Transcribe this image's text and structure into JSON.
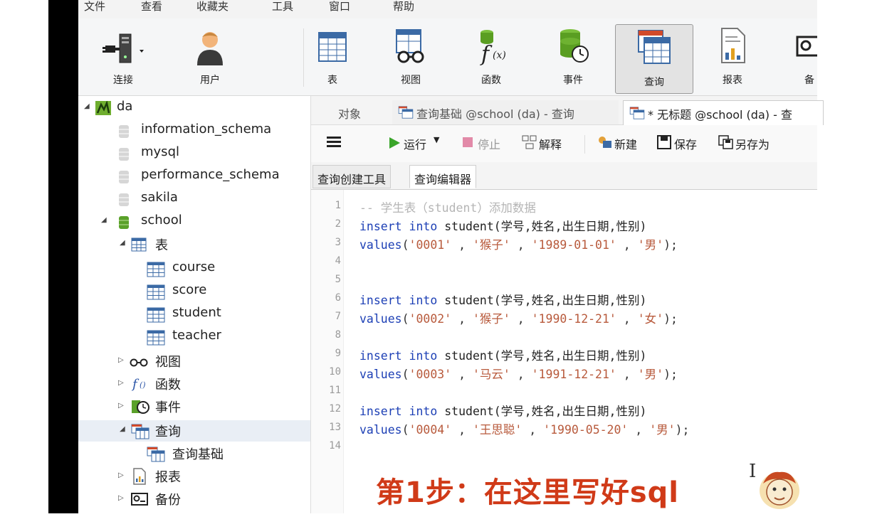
{
  "menu": [
    "文件",
    "查看",
    "收藏夹",
    "工具",
    "窗口",
    "帮助"
  ],
  "toolbar": {
    "connect": "连接",
    "user": "用户",
    "table": "表",
    "view": "视图",
    "function": "函数",
    "event": "事件",
    "query": "查询",
    "report": "报表",
    "backup": "备"
  },
  "tree": {
    "connection": "da",
    "databases": [
      "information_schema",
      "mysql",
      "performance_schema",
      "sakila",
      "school"
    ],
    "tables_group": "表",
    "tables": [
      "course",
      "score",
      "student",
      "teacher"
    ],
    "views": "视图",
    "functions": "函数",
    "events": "事件",
    "queries": "查询",
    "query_item": "查询基础",
    "reports": "报表",
    "backups": "备份"
  },
  "tabs": {
    "objects": "对象",
    "tab1": "查询基础 @school (da) - 查询",
    "tab2": "* 无标题 @school (da) - 查"
  },
  "querybar": {
    "run": "运行",
    "stop": "停止",
    "explain": "解释",
    "new": "新建",
    "save": "保存",
    "save_as": "另存为"
  },
  "subtabs": {
    "builder": "查询创建工具",
    "editor": "查询编辑器"
  },
  "editor": {
    "line_numbers": [
      "1",
      "2",
      "3",
      "4",
      "5",
      "6",
      "7",
      "8",
      "9",
      "10",
      "11",
      "12",
      "13",
      "14"
    ],
    "comment": "-- 学生表（student）添加数据",
    "insert_kw": "insert into",
    "insert_rest": " student(学号,姓名,出生日期,性别)",
    "values_kw": "values",
    "rows": [
      {
        "id": "'0001'",
        "name": "'猴子'",
        "birth": "'1989-01-01'",
        "sex": "'男'"
      },
      {
        "id": "'0002'",
        "name": "'猴子'",
        "birth": "'1990-12-21'",
        "sex": "'女'"
      },
      {
        "id": "'0003'",
        "name": "'马云'",
        "birth": "'1991-12-21'",
        "sex": "'男'"
      },
      {
        "id": "'0004'",
        "name": "'王思聪'",
        "birth": "'1990-05-20'",
        "sex": "'男'"
      }
    ]
  },
  "caption": "第1步：在这里写好sql",
  "colors": {
    "keyword": "#1c3fb5",
    "string": "#b85a3c",
    "caption": "#d03a18"
  }
}
